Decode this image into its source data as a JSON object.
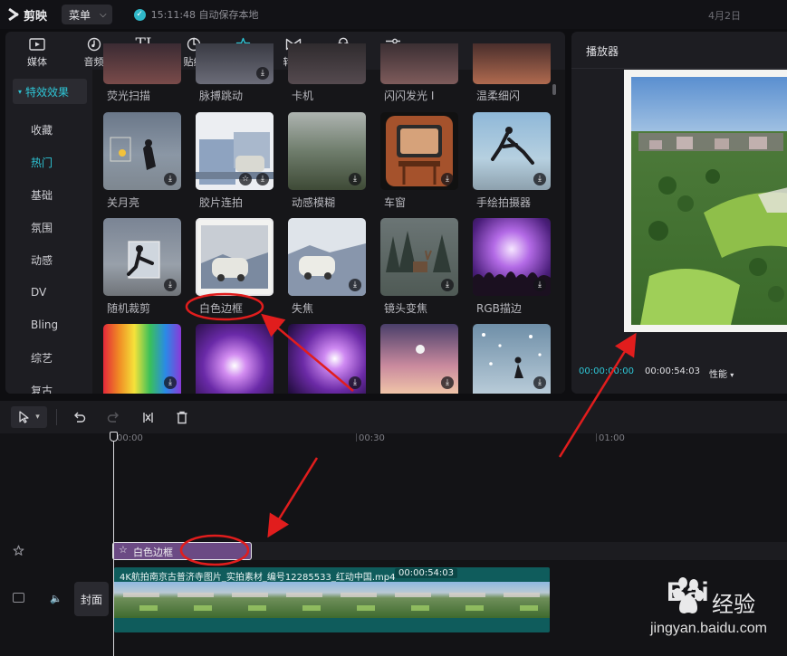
{
  "app": {
    "name": "剪映",
    "menu_label": "菜单",
    "save_status": "15:11:48 自动保存本地",
    "date": "4月2日"
  },
  "tabs": [
    {
      "label": "媒体",
      "icon": "media-icon"
    },
    {
      "label": "音频",
      "icon": "audio-icon"
    },
    {
      "label": "文本",
      "icon": "text-icon"
    },
    {
      "label": "贴纸",
      "icon": "sticker-icon"
    },
    {
      "label": "特效",
      "icon": "effects-icon",
      "active": true
    },
    {
      "label": "转场",
      "icon": "transition-icon"
    },
    {
      "label": "滤镜",
      "icon": "filter-icon"
    },
    {
      "label": "调节",
      "icon": "adjust-icon"
    }
  ],
  "sidebar": {
    "header": "特效效果",
    "items": [
      "收藏",
      "热门",
      "基础",
      "氛围",
      "动感",
      "DV",
      "Bling",
      "综艺",
      "复古"
    ],
    "active": "热门"
  },
  "effects_grid": {
    "partial_row": [
      "荧光扫描",
      "脉搏跳动",
      "卡机",
      "闪闪发光 I",
      "温柔细闪"
    ],
    "row1": [
      "关月亮",
      "胶片连拍",
      "动感模糊",
      "车窗",
      "手绘拍摄器"
    ],
    "row2": [
      "随机裁剪",
      "白色边框",
      "失焦",
      "镜头变焦",
      "RGB描边"
    ],
    "selected": "白色边框"
  },
  "player": {
    "title": "播放器",
    "current_time": "00:00:00:00",
    "total_time": "00:00:54:03",
    "perf_label": "性能"
  },
  "timeline": {
    "ruler": [
      "00:00",
      "00:30",
      "01:00"
    ],
    "effect_clip": "白色边框",
    "video_clip": {
      "name": "4K航拍南京古普济寺图片_实拍素材_编号12285533_红动中国.mp4",
      "duration": "00:00:54:03"
    },
    "cover_label": "封面"
  },
  "watermark": {
    "brand": "Bai",
    "brand_cn": "经验",
    "url": "jingyan.baidu.com"
  },
  "colors": {
    "accent": "#2ec6d6",
    "annotation": "#e11d1d",
    "effect_clip": "#6b4a84",
    "video_clip": "#0f5c5c"
  }
}
